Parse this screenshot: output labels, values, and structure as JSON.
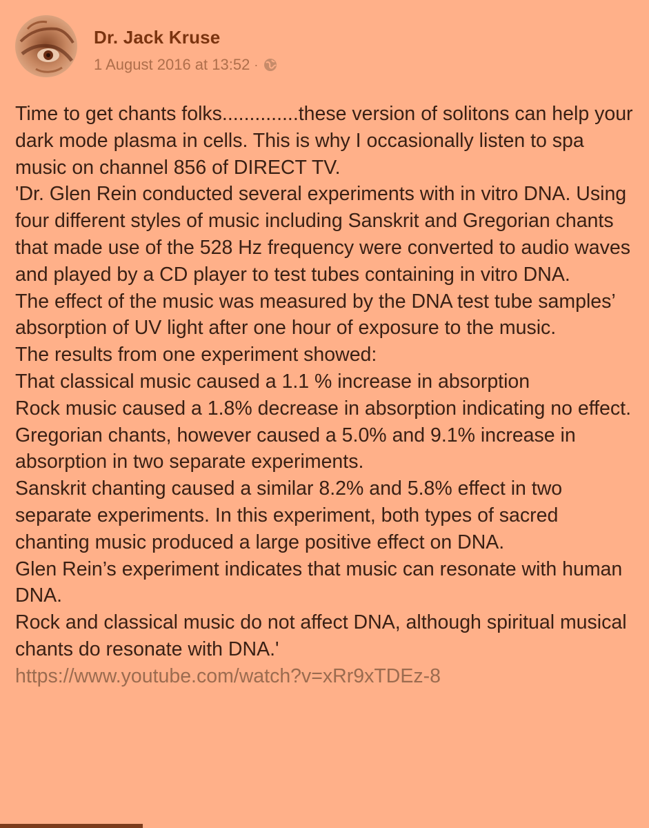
{
  "post": {
    "author": "Dr. Jack Kruse",
    "timestamp": "1 August 2016 at 13:52",
    "separator": "·",
    "privacy_icon": "globe-icon",
    "avatar_icon": "avatar-image",
    "paragraphs": [
      "Time to get chants folks..............these version of solitons can help your dark mode plasma in cells. This is why I occasionally listen to spa music on channel 856 of DIRECT TV.",
      "'Dr. Glen Rein conducted several experiments with in vitro DNA. Using four different styles of music including Sanskrit and Gregorian chants that made use of the 528 Hz frequency were converted to audio waves and played by a CD player to test tubes containing in vitro DNA.",
      "The effect of the music was measured by the DNA test tube samples’ absorption of UV light after one hour of exposure to the music.",
      "The results from one experiment showed:",
      "That classical music caused a 1.1 % increase in absorption",
      "Rock music caused a 1.8% decrease in absorption indicating no effect.",
      "Gregorian chants, however caused a 5.0% and 9.1% increase in absorption in two separate experiments.",
      "Sanskrit chanting caused a similar 8.2% and 5.8% effect in two separate experiments. In this experiment, both types of sacred chanting music produced a large positive effect on DNA.",
      "Glen Rein’s experiment indicates that music can resonate with human DNA.",
      "Rock and classical music do not affect DNA, although spiritual musical chants do resonate with DNA.'"
    ],
    "link": "https://www.youtube.com/watch?v=xRr9xTDEz-8"
  },
  "colors": {
    "background": "#ffb089",
    "author": "#7b3410",
    "meta": "#ae6e4b",
    "text": "#3a2014",
    "link": "#9b6b4f"
  }
}
